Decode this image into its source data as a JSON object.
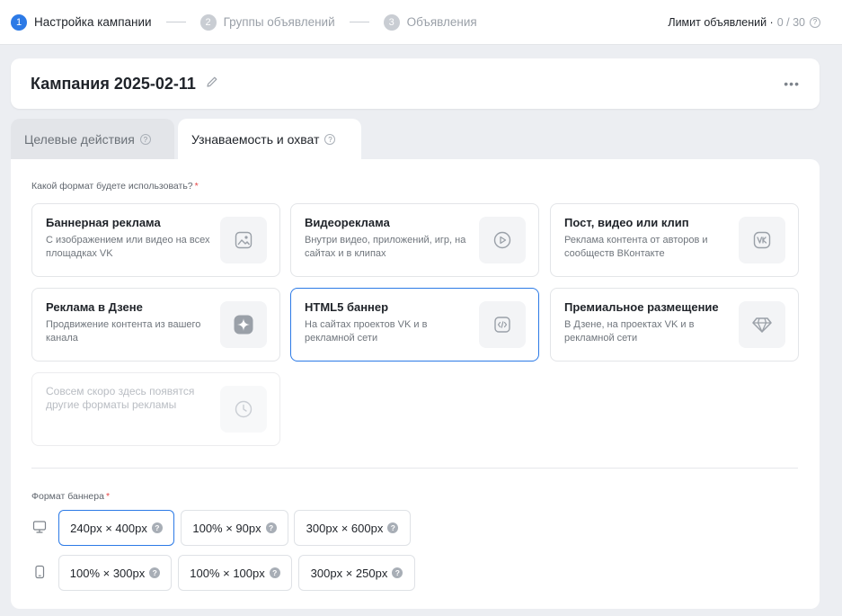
{
  "stepper": {
    "steps": [
      {
        "num": "1",
        "label": "Настройка кампании"
      },
      {
        "num": "2",
        "label": "Группы объявлений"
      },
      {
        "num": "3",
        "label": "Объявления"
      }
    ],
    "limit_label": "Лимит объявлений ·",
    "limit_value": "0 / 30"
  },
  "campaign": {
    "title": "Кампания 2025-02-11",
    "more": "•••"
  },
  "tabs": [
    {
      "label": "Целевые действия"
    },
    {
      "label": "Узнаваемость и охват"
    }
  ],
  "format_question": "Какой формат будете использовать?",
  "required_mark": "*",
  "formats": [
    {
      "title": "Баннерная реклама",
      "desc": "С изображением или видео на всех площадках VK",
      "icon": "image-icon"
    },
    {
      "title": "Видеореклама",
      "desc": "Внутри видео, приложений, игр, на сайтах и в клипах",
      "icon": "play-icon"
    },
    {
      "title": "Пост, видео или клип",
      "desc": "Реклама контента от авторов и сообществ ВКонтакте",
      "icon": "vk-icon"
    },
    {
      "title": "Реклама в Дзене",
      "desc": "Продвижение контента из вашего канала",
      "icon": "dzen-icon"
    },
    {
      "title": "HTML5 баннер",
      "desc": "На сайтах проектов VK и в рекламной сети",
      "icon": "code-icon"
    },
    {
      "title": "Премиальное размещение",
      "desc": "В Дзене, на проектах VK и в рекламной сети",
      "icon": "diamond-icon"
    },
    {
      "title": "",
      "desc": "Совсем скоро здесь появятся другие форматы рекламы",
      "icon": "clock-icon"
    }
  ],
  "banner_format_label": "Формат баннера",
  "sizes_desktop": [
    {
      "label": "240px × 400px"
    },
    {
      "label": "100% × 90px"
    },
    {
      "label": "300px × 600px"
    }
  ],
  "sizes_mobile": [
    {
      "label": "100% × 300px"
    },
    {
      "label": "100% × 100px"
    },
    {
      "label": "300px × 250px"
    }
  ],
  "help_glyph": "?",
  "colors": {
    "accent": "#2c7ae6",
    "required": "#e64646"
  }
}
